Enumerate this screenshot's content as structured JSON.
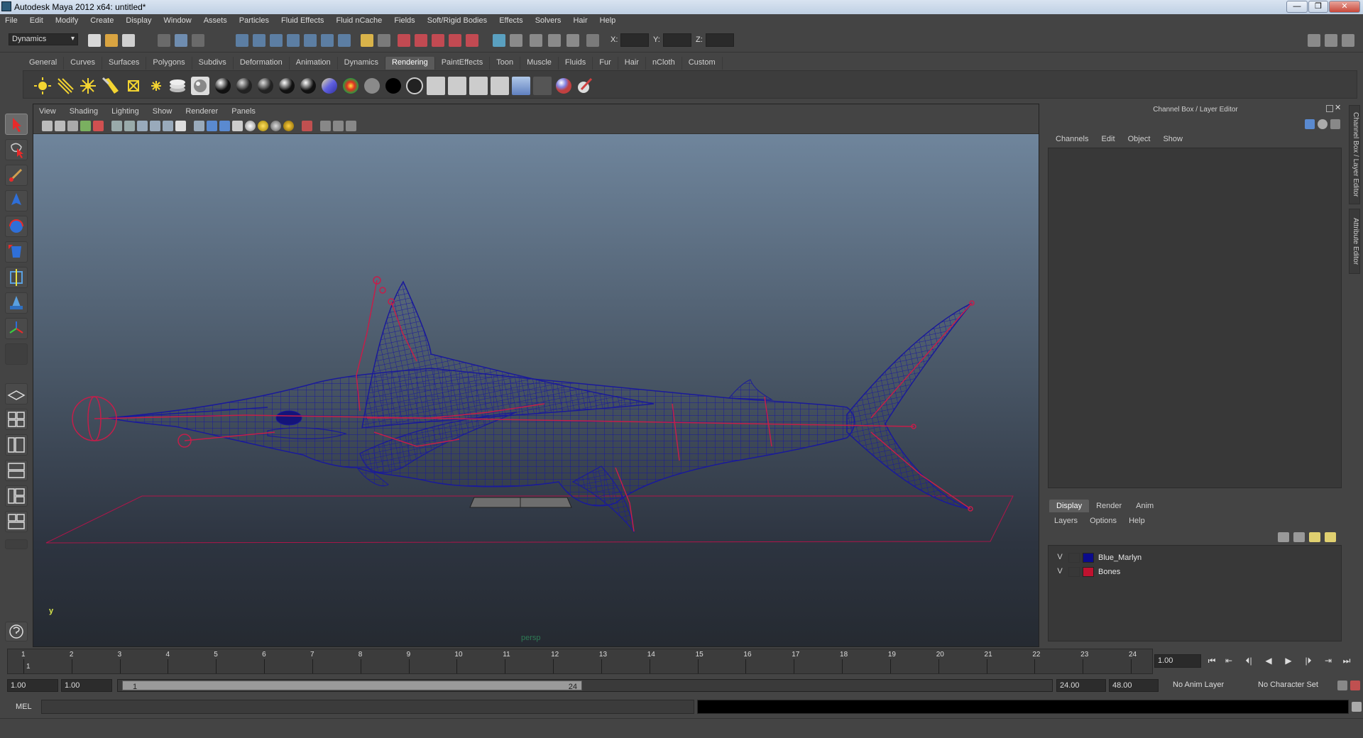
{
  "window": {
    "title": "Autodesk Maya 2012 x64: untitled*",
    "controls": [
      "—",
      "❐",
      "✕"
    ]
  },
  "menubar": [
    "File",
    "Edit",
    "Modify",
    "Create",
    "Display",
    "Window",
    "Assets",
    "Particles",
    "Fluid Effects",
    "Fluid nCache",
    "Fields",
    "Soft/Rigid Bodies",
    "Effects",
    "Solvers",
    "Hair",
    "Help"
  ],
  "statusline": {
    "mode": "Dynamics",
    "x_label": "X:",
    "y_label": "Y:",
    "z_label": "Z:"
  },
  "shelf": {
    "tabs": [
      "General",
      "Curves",
      "Surfaces",
      "Polygons",
      "Subdivs",
      "Deformation",
      "Animation",
      "Dynamics",
      "Rendering",
      "PaintEffects",
      "Toon",
      "Muscle",
      "Fluids",
      "Fur",
      "Hair",
      "nCloth",
      "Custom"
    ],
    "active_tab": "Rendering"
  },
  "viewport": {
    "menu": [
      "View",
      "Shading",
      "Lighting",
      "Show",
      "Renderer",
      "Panels"
    ],
    "camera_label": "persp",
    "axis_label": "y"
  },
  "channel_box": {
    "title": "Channel Box / Layer Editor",
    "menu": [
      "Channels",
      "Edit",
      "Object",
      "Show"
    ]
  },
  "layer_editor": {
    "tabs": [
      "Display",
      "Render",
      "Anim"
    ],
    "active_tab": "Display",
    "menu": [
      "Layers",
      "Options",
      "Help"
    ],
    "layers": [
      {
        "visible": "V",
        "name": "Blue_Marlyn",
        "color": "#0b0b8c"
      },
      {
        "visible": "V",
        "name": "Bones",
        "color": "#c0122f"
      }
    ]
  },
  "side_tabs": [
    "Channel Box / Layer Editor",
    "Attribute Editor"
  ],
  "time_slider": {
    "ticks": [
      "1",
      "2",
      "3",
      "4",
      "5",
      "6",
      "7",
      "8",
      "9",
      "10",
      "11",
      "12",
      "13",
      "14",
      "15",
      "16",
      "17",
      "18",
      "19",
      "20",
      "21",
      "22",
      "23",
      "24"
    ],
    "current_frame_label": "1",
    "current_frame_field": "1.00"
  },
  "playback_controls": [
    "⏮",
    "⇤",
    "⏴|",
    "◀",
    "▶",
    "|⏵",
    "⇥",
    "⏭"
  ],
  "range_slider": {
    "start_time": "1.00",
    "playback_start": "1.00",
    "handle_start": "1",
    "handle_end": "24",
    "playback_end": "24.00",
    "end_time": "48.00",
    "anim_layer": "No Anim Layer",
    "character_set": "No Character Set"
  },
  "command_line": {
    "label": "MEL"
  },
  "colors": {
    "wire_blue": "#1a1a8c",
    "bones_red": "#c41e4a",
    "ui_bg": "#444444"
  }
}
